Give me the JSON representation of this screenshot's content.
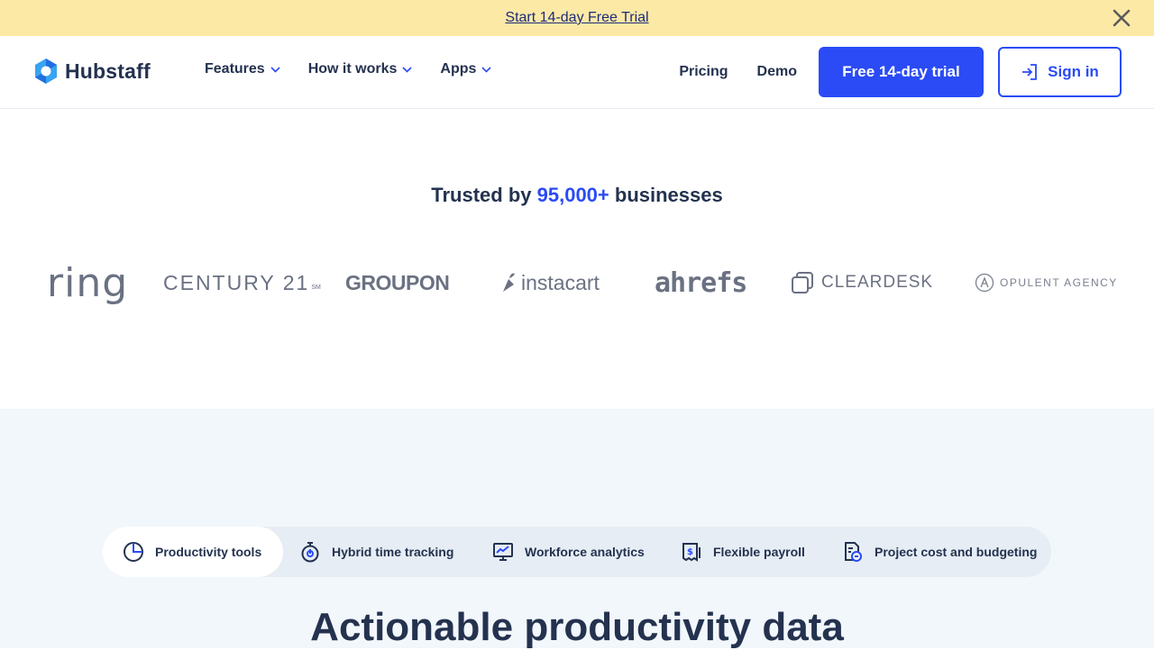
{
  "promo": {
    "link_text": "Start 14-day Free Trial"
  },
  "header": {
    "logo_text": "Hubstaff",
    "nav": [
      {
        "label": "Features"
      },
      {
        "label": "How it works"
      },
      {
        "label": "Apps"
      }
    ],
    "pricing": "Pricing",
    "demo": "Demo",
    "trial_button": "Free 14-day trial",
    "signin_button": "Sign in"
  },
  "trusted": {
    "prefix": "Trusted by ",
    "highlight": "95,000+",
    "suffix": " businesses"
  },
  "brands": [
    "ring",
    "CENTURY 21",
    "GROUPON",
    "instacart",
    "ahrefs",
    "CLEARDESK",
    "OPULENT AGENCY"
  ],
  "tabs": [
    {
      "label": "Productivity tools",
      "icon": "pie-chart-icon",
      "active": true
    },
    {
      "label": "Hybrid time tracking",
      "icon": "stopwatch-icon"
    },
    {
      "label": "Workforce analytics",
      "icon": "monitor-chart-icon"
    },
    {
      "label": "Flexible payroll",
      "icon": "payroll-icon"
    },
    {
      "label": "Project cost and budgeting",
      "icon": "budget-icon"
    }
  ],
  "headline": "Actionable productivity data",
  "colors": {
    "accent": "#2a4bf5",
    "banner": "#fde9a6",
    "text": "#24324f",
    "section_bg": "#f2f7fc"
  }
}
